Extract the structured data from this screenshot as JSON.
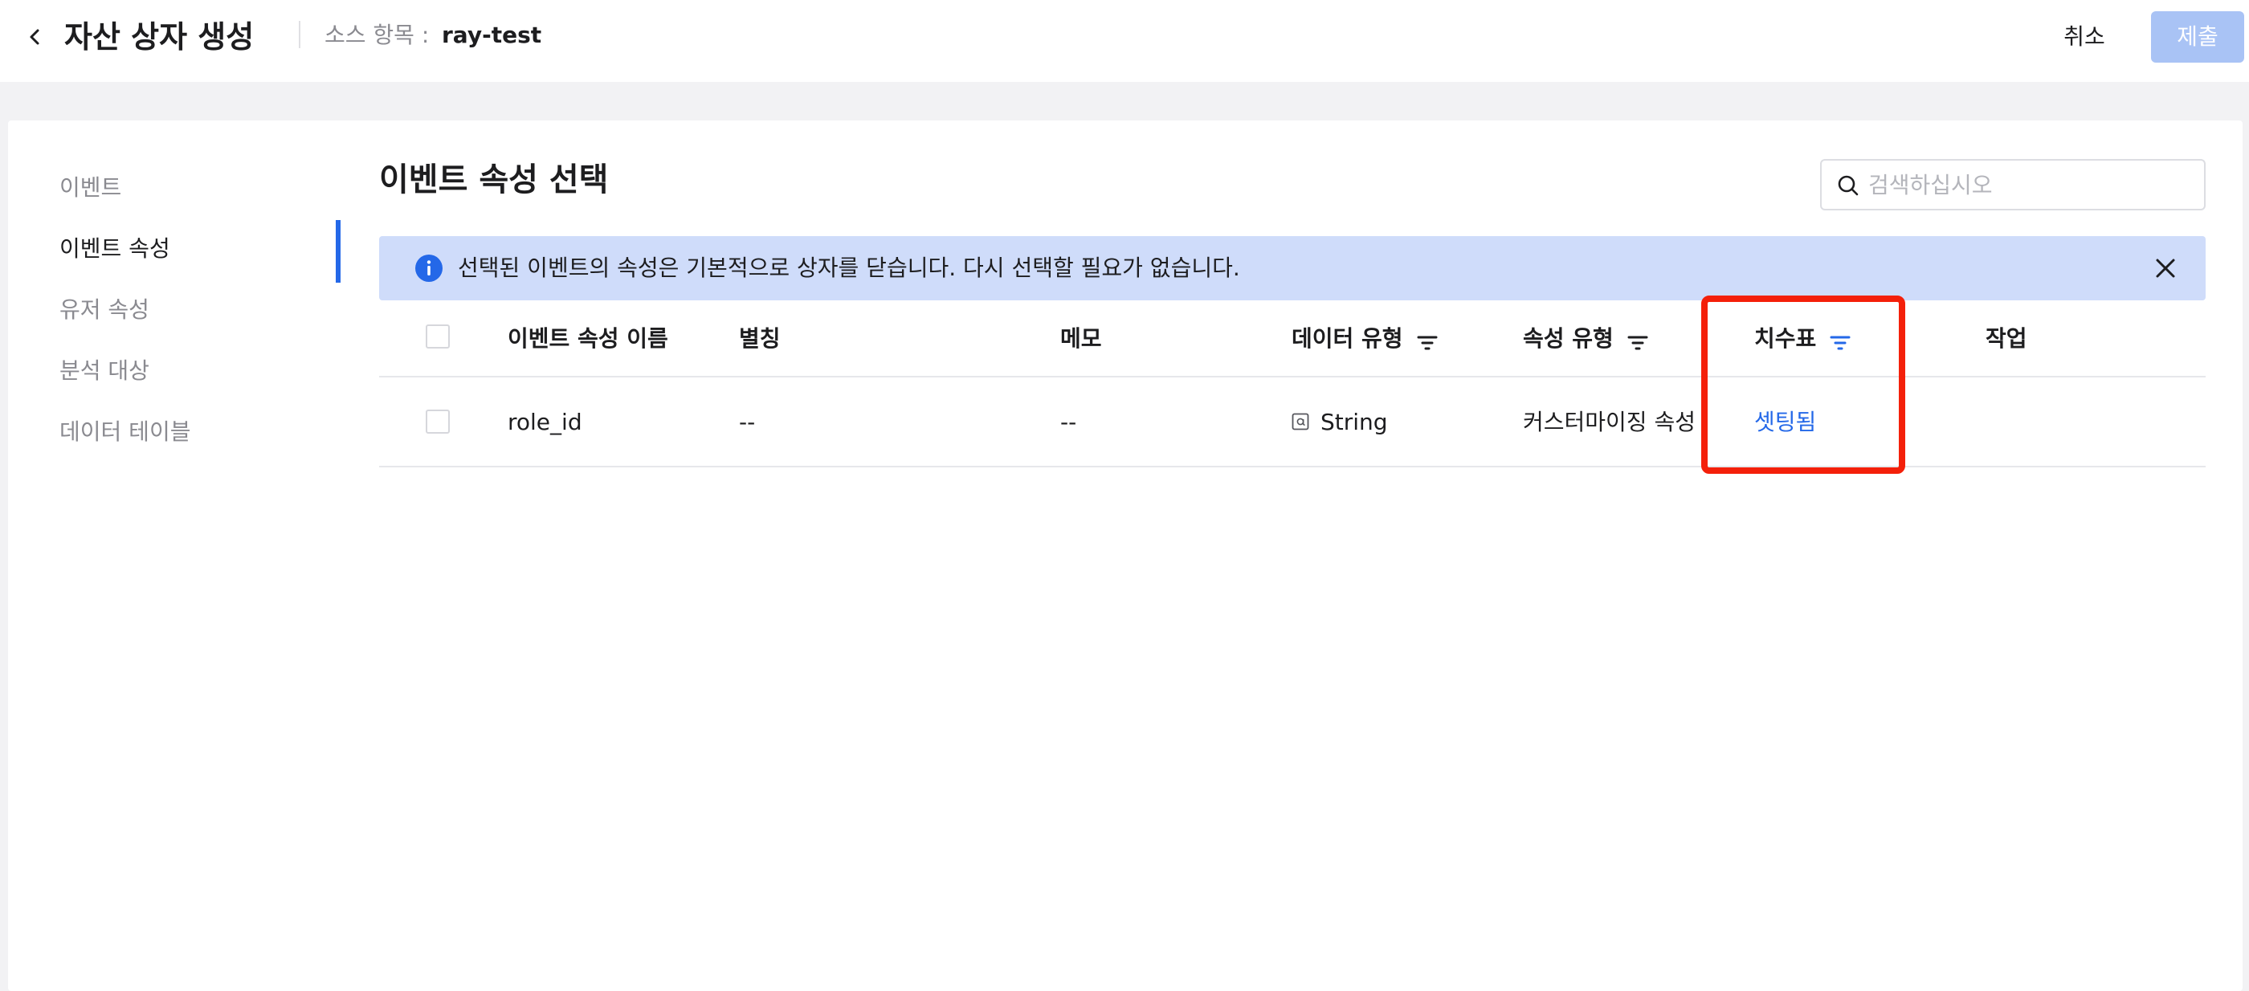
{
  "header": {
    "title": "자산 상자 생성",
    "source_label": "소스 항목 :",
    "source_value": "ray-test",
    "cancel_label": "취소",
    "submit_label": "제출"
  },
  "sidebar": {
    "items": [
      {
        "label": "이벤트",
        "active": false
      },
      {
        "label": "이벤트 속성",
        "active": true
      },
      {
        "label": "유저 속성",
        "active": false
      },
      {
        "label": "분석 대상",
        "active": false
      },
      {
        "label": "데이터 테이블",
        "active": false
      }
    ]
  },
  "main": {
    "section_title": "이벤트 속성 선택",
    "search": {
      "placeholder": "검색하십시오",
      "value": ""
    },
    "banner": {
      "icon": "info-icon",
      "text": "선택된 이벤트의 속성은 기본적으로 상자를 닫습니다. 다시 선택할 필요가 없습니다."
    }
  },
  "table": {
    "columns": [
      "이벤트 속성 이름",
      "별칭",
      "메모",
      "데이터 유형",
      "속성 유형",
      "치수표",
      "작업"
    ],
    "rows": [
      {
        "name": "role_id",
        "alias": "--",
        "memo": "--",
        "data_type": "String",
        "prop_type": "커스터마이징 속성",
        "dimension": "셋팅됨",
        "action": ""
      }
    ]
  },
  "colors": {
    "accent": "#2468e8",
    "submit_disabled": "#a9c3f5",
    "banner_bg": "#cfdcfa",
    "highlight": "#f4200a"
  }
}
